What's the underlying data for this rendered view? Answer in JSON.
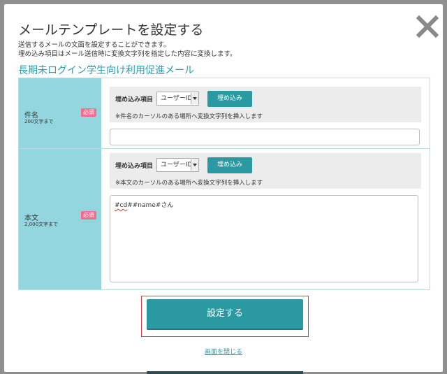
{
  "dialog": {
    "title": "メールテンプレートを設定する",
    "description_line1": "送信するメールの文面を設定することができます。",
    "description_line2": "埋め込み項目はメール送信時に変換文字列を指定した内容に変換します。",
    "template_name": "長期未ログイン学生向け利用促進メール",
    "close_icon": "close-icon"
  },
  "colors": {
    "accent": "#2a99a2",
    "label_bg": "#93d6df",
    "required_badge": "#f36b8e",
    "highlight_frame": "#d73a4a"
  },
  "fields": [
    {
      "label": "件名",
      "limit": "200文字まで",
      "required": "必須",
      "embed_label": "埋め込み項目",
      "embed_selected": "ユーザーID",
      "embed_button": "埋め込み",
      "embed_hint": "※件名のカーソルのある場所へ変換文字列を挿入します",
      "value": ""
    },
    {
      "label": "本文",
      "limit": "2,000文字まで",
      "required": "必須",
      "embed_label": "埋め込み項目",
      "embed_selected": "ユーザーID",
      "embed_button": "埋め込み",
      "embed_hint": "※本文のカーソルのある場所へ変換文字列を挿入します",
      "value_prefix": "#cd",
      "value_rest": "##name#さん"
    }
  ],
  "actions": {
    "submit": "設定する",
    "close_link": "画面を閉じる"
  }
}
